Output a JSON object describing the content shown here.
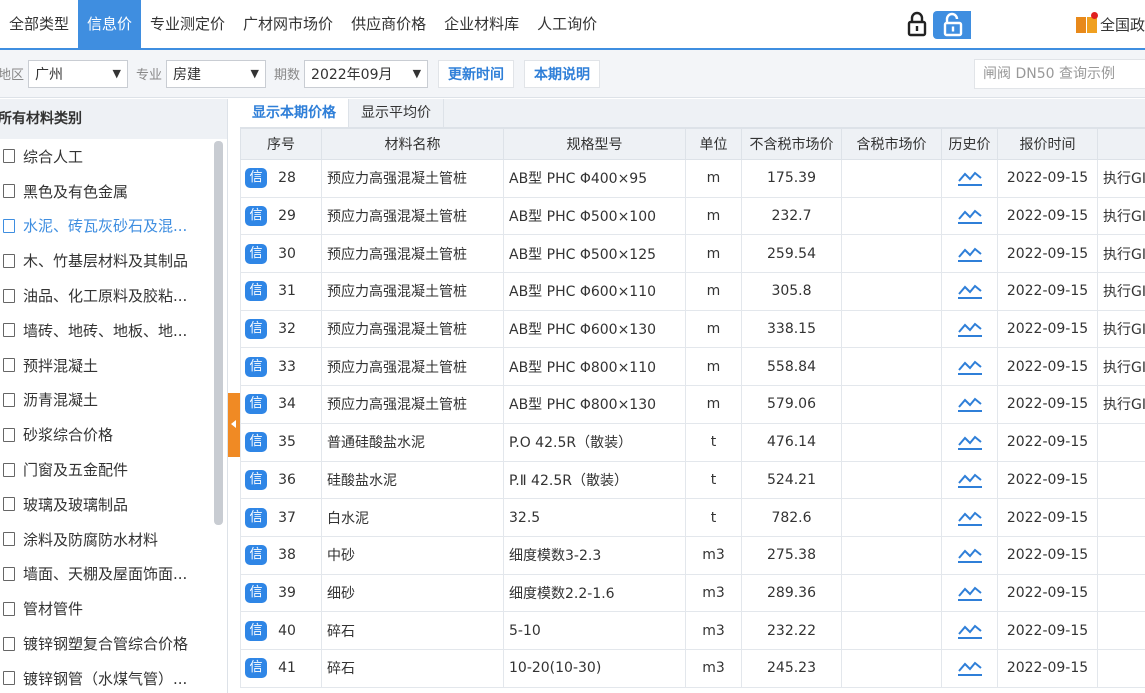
{
  "nav": {
    "tabs": [
      "全部类型",
      "信息价",
      "专业测定价",
      "广材网市场价",
      "供应商价格",
      "企业材料库",
      "人工询价"
    ],
    "active_index": 1,
    "national_label": "全国政"
  },
  "filters": {
    "region_label": "地区",
    "region_value": "广州",
    "major_label": "专业",
    "major_value": "房建",
    "period_label": "期数",
    "period_value": "2022年09月",
    "update_time_label": "更新时间",
    "period_desc_label": "本期说明",
    "search_placeholder": "闸阀 DN50 查询示例"
  },
  "sidebar": {
    "title": "所有材料类别",
    "active_index": 2,
    "items": [
      "综合人工",
      "黑色及有色金属",
      "水泥、砖瓦灰砂石及混...",
      "木、竹基层材料及其制品",
      "油品、化工原料及胶粘...",
      "墙砖、地砖、地板、地...",
      "预拌混凝土",
      "沥青混凝土",
      "砂浆综合价格",
      "门窗及五金配件",
      "玻璃及玻璃制品",
      "涂料及防腐防水材料",
      "墙面、天棚及屋面饰面...",
      "管材管件",
      "镀锌钢塑复合管综合价格",
      "镀锌钢管（水煤气管）..."
    ]
  },
  "subtabs": [
    "显示本期价格",
    "显示平均价"
  ],
  "table": {
    "columns": [
      "序号",
      "材料名称",
      "规格型号",
      "单位",
      "不含税市场价",
      "含税市场价",
      "历史价",
      "报价时间",
      ""
    ],
    "badge": "信",
    "rows": [
      {
        "seq": "28",
        "name": "预应力高强混凝土管桩",
        "spec": "AB型 PHC Φ400×95",
        "unit": "m",
        "price": "175.39",
        "tax_price": "",
        "date": "2022-09-15",
        "note": "执行GI"
      },
      {
        "seq": "29",
        "name": "预应力高强混凝土管桩",
        "spec": "AB型 PHC Φ500×100",
        "unit": "m",
        "price": "232.7",
        "tax_price": "",
        "date": "2022-09-15",
        "note": "执行GI"
      },
      {
        "seq": "30",
        "name": "预应力高强混凝土管桩",
        "spec": "AB型 PHC Φ500×125",
        "unit": "m",
        "price": "259.54",
        "tax_price": "",
        "date": "2022-09-15",
        "note": "执行GI"
      },
      {
        "seq": "31",
        "name": "预应力高强混凝土管桩",
        "spec": "AB型 PHC Φ600×110",
        "unit": "m",
        "price": "305.8",
        "tax_price": "",
        "date": "2022-09-15",
        "note": "执行GI"
      },
      {
        "seq": "32",
        "name": "预应力高强混凝土管桩",
        "spec": "AB型 PHC Φ600×130",
        "unit": "m",
        "price": "338.15",
        "tax_price": "",
        "date": "2022-09-15",
        "note": "执行GI"
      },
      {
        "seq": "33",
        "name": "预应力高强混凝土管桩",
        "spec": "AB型 PHC Φ800×110",
        "unit": "m",
        "price": "558.84",
        "tax_price": "",
        "date": "2022-09-15",
        "note": "执行GI"
      },
      {
        "seq": "34",
        "name": "预应力高强混凝土管桩",
        "spec": "AB型 PHC Φ800×130",
        "unit": "m",
        "price": "579.06",
        "tax_price": "",
        "date": "2022-09-15",
        "note": "执行GI"
      },
      {
        "seq": "35",
        "name": "普通硅酸盐水泥",
        "spec": "P.O 42.5R（散装）",
        "unit": "t",
        "price": "476.14",
        "tax_price": "",
        "date": "2022-09-15",
        "note": ""
      },
      {
        "seq": "36",
        "name": "硅酸盐水泥",
        "spec": "P.Ⅱ 42.5R（散装）",
        "unit": "t",
        "price": "524.21",
        "tax_price": "",
        "date": "2022-09-15",
        "note": ""
      },
      {
        "seq": "37",
        "name": "白水泥",
        "spec": "32.5",
        "unit": "t",
        "price": "782.6",
        "tax_price": "",
        "date": "2022-09-15",
        "note": ""
      },
      {
        "seq": "38",
        "name": "中砂",
        "spec": "细度模数3-2.3",
        "unit": "m3",
        "price": "275.38",
        "tax_price": "",
        "date": "2022-09-15",
        "note": ""
      },
      {
        "seq": "39",
        "name": "细砂",
        "spec": "细度模数2.2-1.6",
        "unit": "m3",
        "price": "289.36",
        "tax_price": "",
        "date": "2022-09-15",
        "note": ""
      },
      {
        "seq": "40",
        "name": "碎石",
        "spec": "5-10",
        "unit": "m3",
        "price": "232.22",
        "tax_price": "",
        "date": "2022-09-15",
        "note": ""
      },
      {
        "seq": "41",
        "name": "碎石",
        "spec": "10-20(10-30)",
        "unit": "m3",
        "price": "245.23",
        "tax_price": "",
        "date": "2022-09-15",
        "note": ""
      }
    ]
  },
  "colors": {
    "accent": "#3f8ee0",
    "link": "#2f7fd8",
    "badge": "#2f86e6",
    "handle": "#f08a24"
  }
}
